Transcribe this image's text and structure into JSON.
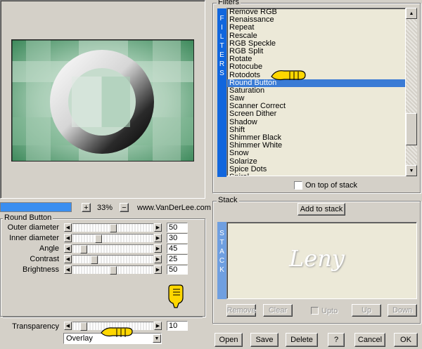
{
  "preview": {
    "progress": 1.0
  },
  "zoom": {
    "plus": "+",
    "value": "33%",
    "minus": "−",
    "site": "www.VanDerLee.com"
  },
  "filters": {
    "title": "Filters",
    "side_label": "FILTERS",
    "items": [
      "Remove RGB",
      "Renaissance",
      "Repeat",
      "Rescale",
      "RGB Speckle",
      "RGB Split",
      "Rotate",
      "Rotocube",
      "Rotodots",
      "Round Button",
      "Saturation",
      "Saw",
      "Scanner Correct",
      "Screen Dither",
      "Shadow",
      "Shift",
      "Shimmer Black",
      "Shimmer White",
      "Snow",
      "Solarize",
      "Spice Dots",
      "Spiral"
    ],
    "selected_index": 9,
    "on_top_label": "On top of stack"
  },
  "params": {
    "title": "Round Button",
    "rows": [
      {
        "label": "Outer diameter",
        "value": "50",
        "level": 0.5
      },
      {
        "label": "Inner diameter",
        "value": "30",
        "level": 0.3
      },
      {
        "label": "Angle",
        "value": "45",
        "level": 0.1
      },
      {
        "label": "Contrast",
        "value": "25",
        "level": 0.25
      },
      {
        "label": "Brightness",
        "value": "50",
        "level": 0.5
      }
    ],
    "transparency": {
      "label": "Transparency",
      "value": "10",
      "level": 0.1
    },
    "blend_mode": "Overlay"
  },
  "stack": {
    "title": "Stack",
    "add_label": "Add to stack",
    "side_label": "STACK",
    "watermark": "Leny",
    "remove": "Remove",
    "clear": "Clear",
    "upto": "Upto",
    "up": "Up",
    "down": "Down"
  },
  "footer": {
    "open": "Open",
    "save": "Save",
    "delete": "Delete",
    "help": "?",
    "cancel": "Cancel",
    "ok": "OK"
  },
  "colors": {
    "accent": "#1166dd",
    "selection": "#3a7bd5",
    "list_bg": "#ece9d8",
    "face": "#d4d0c8"
  }
}
